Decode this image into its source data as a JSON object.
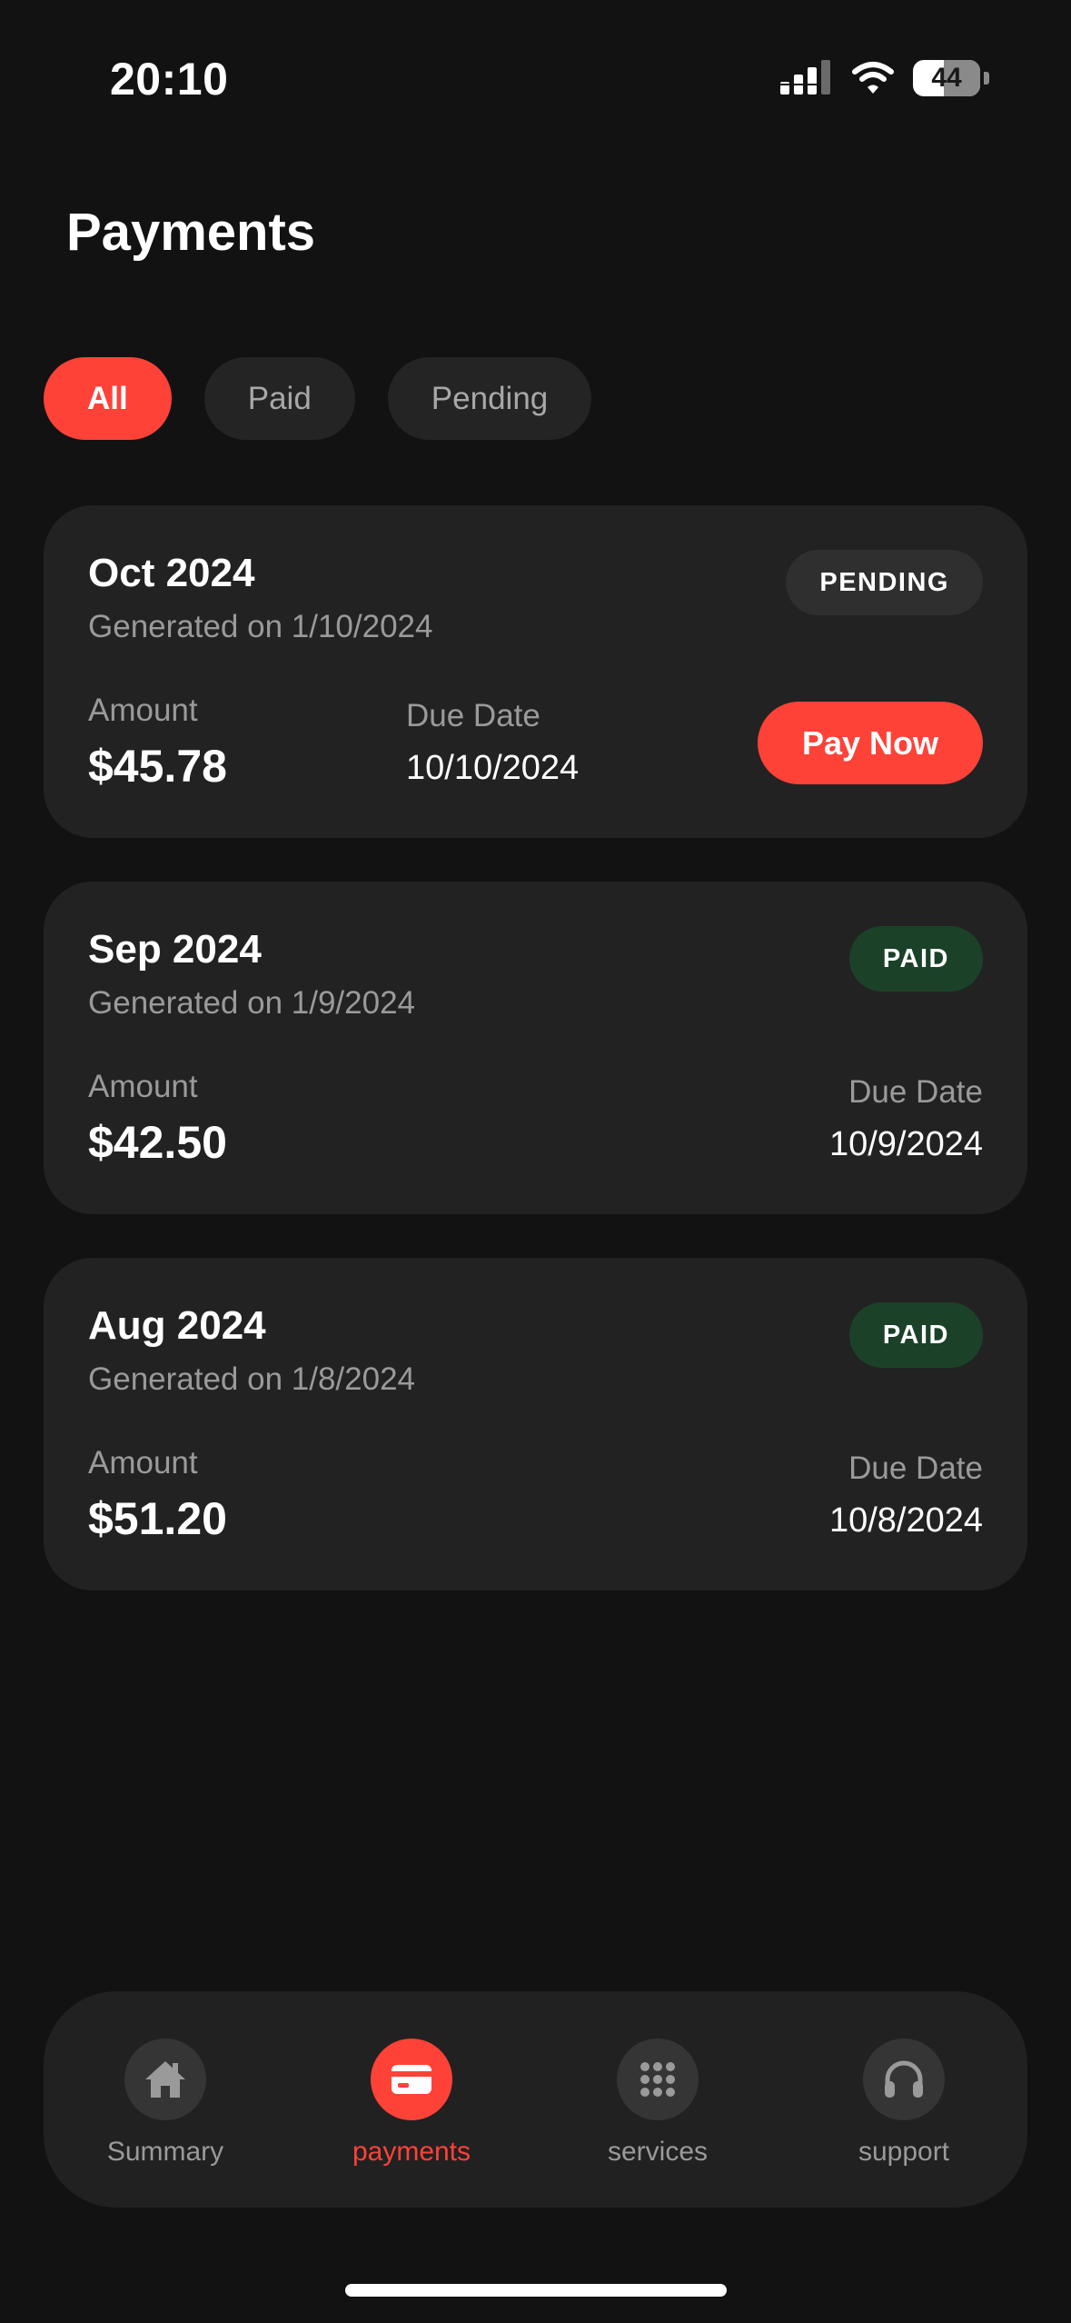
{
  "status_bar": {
    "time": "20:10",
    "battery": "44"
  },
  "header": {
    "title": "Payments"
  },
  "filters": [
    {
      "label": "All",
      "active": true
    },
    {
      "label": "Paid",
      "active": false
    },
    {
      "label": "Pending",
      "active": false
    }
  ],
  "payments": [
    {
      "month": "Oct 2024",
      "generated": "Generated on 1/10/2024",
      "status": "PENDING",
      "amount_label": "Amount",
      "amount": "$45.78",
      "due_label": "Due Date",
      "due_date": "10/10/2024",
      "action_label": "Pay Now"
    },
    {
      "month": "Sep 2024",
      "generated": "Generated on 1/9/2024",
      "status": "PAID",
      "amount_label": "Amount",
      "amount": "$42.50",
      "due_label": "Due Date",
      "due_date": "10/9/2024"
    },
    {
      "month": "Aug 2024",
      "generated": "Generated on 1/8/2024",
      "status": "PAID",
      "amount_label": "Amount",
      "amount": "$51.20",
      "due_label": "Due Date",
      "due_date": "10/8/2024"
    }
  ],
  "bottom_nav": [
    {
      "label": "Summary",
      "icon": "home-icon",
      "active": false
    },
    {
      "label": "payments",
      "icon": "credit-card-icon",
      "active": true
    },
    {
      "label": "services",
      "icon": "grid-icon",
      "active": false
    },
    {
      "label": "support",
      "icon": "headphones-icon",
      "active": false
    }
  ],
  "colors": {
    "background": "#121212",
    "card": "#222222",
    "accent": "#ff4238",
    "paid_badge": "#1b4229",
    "pending_badge": "#2f2f2f",
    "muted_text": "#9a9a9a"
  }
}
